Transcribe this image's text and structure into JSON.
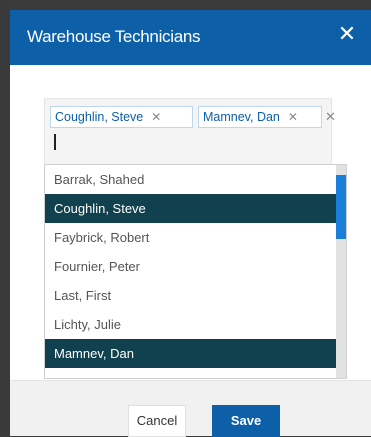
{
  "dialog": {
    "title": "Warehouse Technicians",
    "close_glyph": "✕"
  },
  "selected": [
    {
      "label": "Coughlin, Steve",
      "remove_glyph": "✕"
    },
    {
      "label": "Mamnev, Dan",
      "remove_glyph": "✕"
    }
  ],
  "clear_all_glyph": "✕",
  "options": [
    {
      "label": "Barrak, Shahed",
      "selected": false
    },
    {
      "label": "Coughlin, Steve",
      "selected": true
    },
    {
      "label": "Faybrick, Robert",
      "selected": false
    },
    {
      "label": "Fournier, Peter",
      "selected": false
    },
    {
      "label": "Last, First",
      "selected": false
    },
    {
      "label": "Lichty, Julie",
      "selected": false
    },
    {
      "label": "Mamnev, Dan",
      "selected": true
    }
  ],
  "footer": {
    "cancel_label": "Cancel",
    "save_label": "Save"
  },
  "colors": {
    "header": "#0d5fa8",
    "selected_option": "#11414e",
    "scrollbar": "#1a7fd8",
    "tag_text": "#0d5fa8"
  },
  "icons": {
    "close": "close-icon",
    "tag_remove": "remove-tag-icon",
    "clear": "clear-all-icon"
  }
}
